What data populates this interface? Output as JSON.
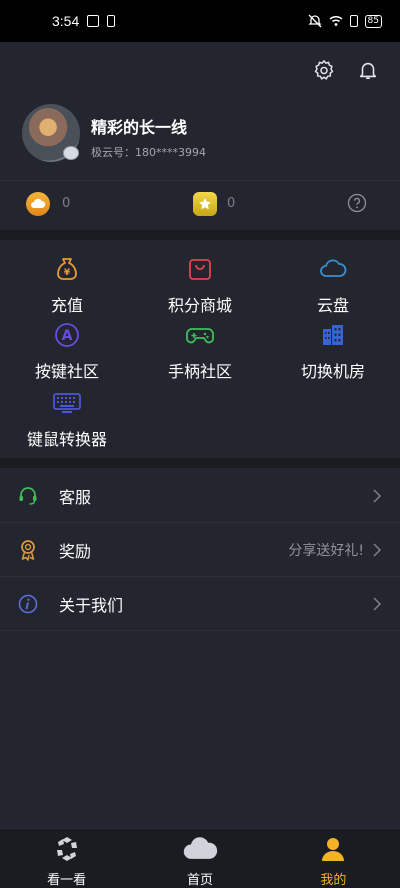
{
  "status_bar": {
    "time": "3:54",
    "battery": "85"
  },
  "profile": {
    "username": "精彩的长一线",
    "account_id": "极云号：180****3994"
  },
  "wallet": {
    "coin_value": "0",
    "star_value": "0"
  },
  "grid": [
    {
      "label": "充值",
      "color": "#e59a36"
    },
    {
      "label": "积分商城",
      "color": "#e2434f"
    },
    {
      "label": "云盘",
      "color": "#3a8fd0"
    },
    {
      "label": "按键社区",
      "color": "#6a4be0"
    },
    {
      "label": "手柄社区",
      "color": "#3fbf5a"
    },
    {
      "label": "切换机房",
      "color": "#3764d1"
    },
    {
      "label": "键鼠转换器",
      "color": "#4d56d6"
    }
  ],
  "menu": [
    {
      "label": "客服",
      "extra": ""
    },
    {
      "label": "奖励",
      "extra": "分享送好礼!"
    },
    {
      "label": "关于我们",
      "extra": ""
    }
  ],
  "tabs": [
    {
      "label": "看一看"
    },
    {
      "label": "首页"
    },
    {
      "label": "我的",
      "active_color": "#f2b324"
    }
  ]
}
